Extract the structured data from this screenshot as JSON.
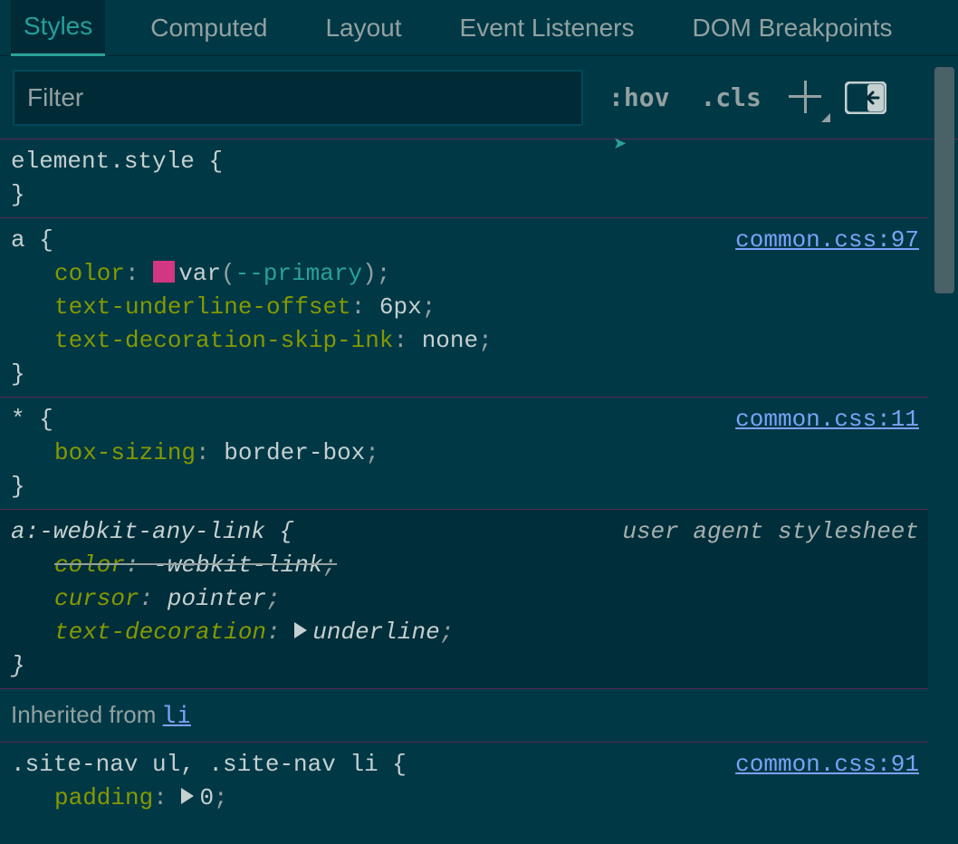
{
  "tabs": {
    "styles": "Styles",
    "computed": "Computed",
    "layout": "Layout",
    "event_listeners": "Event Listeners",
    "dom_breakpoints": "DOM Breakpoints"
  },
  "toolbar": {
    "filter_placeholder": "Filter",
    "hov": ":hov",
    "cls": ".cls"
  },
  "rules": {
    "element_style": {
      "selector": "element.style"
    },
    "a_rule": {
      "selector": "a",
      "source": "common.css:97",
      "props": {
        "color_name": "color",
        "color_var_kw": "var",
        "color_var_name": "--primary",
        "tuo_name": "text-underline-offset",
        "tuo_value": "6px",
        "tdsi_name": "text-decoration-skip-ink",
        "tdsi_value": "none"
      }
    },
    "star_rule": {
      "selector": "*",
      "source": "common.css:11",
      "props": {
        "bs_name": "box-sizing",
        "bs_value": "border-box"
      }
    },
    "ua_rule": {
      "selector": "a:-webkit-any-link",
      "label": "user agent stylesheet",
      "props": {
        "color_name": "color",
        "color_value": "-webkit-link",
        "cursor_name": "cursor",
        "cursor_value": "pointer",
        "td_name": "text-decoration",
        "td_value": "underline"
      }
    },
    "inherited": {
      "label": "Inherited from ",
      "from": "li"
    },
    "nav_rule": {
      "selector": ".site-nav ul, .site-nav li",
      "source": "common.css:91",
      "props": {
        "padding_name": "padding",
        "padding_value": "0"
      }
    }
  },
  "swatch_color": "#d33682"
}
